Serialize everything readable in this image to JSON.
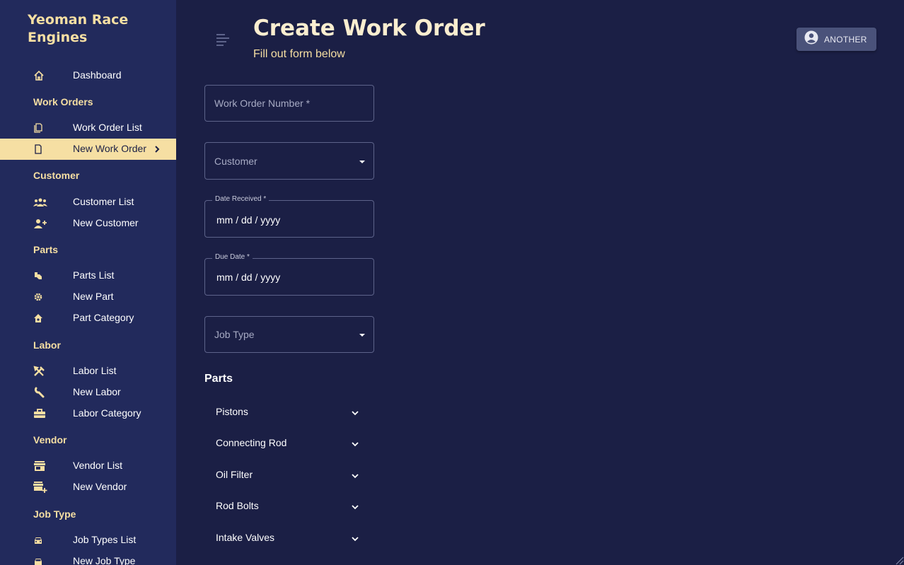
{
  "brand": "Yeoman Race Engines",
  "sidebar": {
    "dashboard": "Dashboard",
    "sections": {
      "work_orders": "Work Orders",
      "customer": "Customer",
      "parts": "Parts",
      "labor": "Labor",
      "vendor": "Vendor",
      "job_type": "Job Type"
    },
    "items": {
      "work_order_list": "Work Order List",
      "new_work_order": "New Work Order",
      "customer_list": "Customer List",
      "new_customer": "New Customer",
      "parts_list": "Parts List",
      "new_part": "New Part",
      "part_category": "Part Category",
      "labor_list": "Labor List",
      "new_labor": "New Labor",
      "labor_category": "Labor Category",
      "vendor_list": "Vendor List",
      "new_vendor": "New Vendor",
      "job_types_list": "Job Types List",
      "new_job_type": "New Job Type"
    },
    "active_item": "New Work Order"
  },
  "header": {
    "title": "Create Work Order",
    "subtitle": "Fill out form below",
    "user_button": "ANOTHER"
  },
  "form": {
    "work_order_number": {
      "placeholder": "Work Order Number *"
    },
    "customer": {
      "placeholder": "Customer"
    },
    "date_received": {
      "label": "Date Received *",
      "value": "mm / dd / yyyy"
    },
    "due_date": {
      "label": "Due Date *",
      "value": "mm / dd / yyyy"
    },
    "job_type": {
      "placeholder": "Job Type"
    }
  },
  "parts": {
    "title": "Parts",
    "items": [
      "Pistons",
      "Connecting Rod",
      "Oil Filter",
      "Rod Bolts",
      "Intake Valves"
    ]
  },
  "colors": {
    "background": "#1b1f45",
    "sidebar": "#222a5c",
    "accent": "#f6dfa3"
  }
}
